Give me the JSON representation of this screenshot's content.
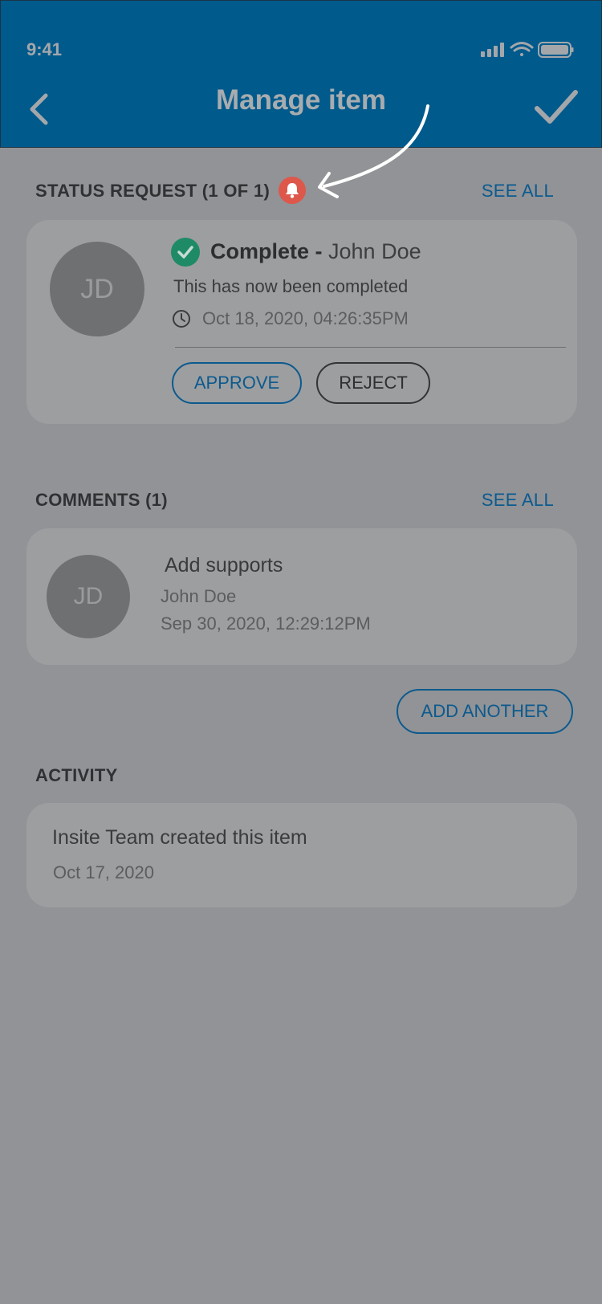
{
  "status_bar": {
    "time": "9:41"
  },
  "header": {
    "title": "Manage item"
  },
  "status_request": {
    "title": "STATUS REQUEST (1 OF 1)",
    "see_all": "SEE ALL",
    "card": {
      "initials": "JD",
      "status": "Complete - ",
      "user": "John Doe",
      "message": "This has now been completed",
      "timestamp": "Oct 18, 2020, 04:26:35PM",
      "approve": "APPROVE",
      "reject": "REJECT"
    }
  },
  "comments": {
    "title": "COMMENTS (1)",
    "see_all": "SEE ALL",
    "item": {
      "initials": "JD",
      "text": "Add supports",
      "author": "John Doe",
      "timestamp": "Sep 30, 2020, 12:29:12PM"
    },
    "add_another": "ADD ANOTHER"
  },
  "activity": {
    "title": "ACTIVITY",
    "item": {
      "text": "Insite Team created this item",
      "date": "Oct 17, 2020"
    }
  },
  "colors": {
    "header_bg": "#015a8c",
    "accent": "#0b5a90",
    "alert": "#dd584b",
    "success": "#1f8b66",
    "overlay_bg": "#929396"
  },
  "icons": [
    "back-chevron-icon",
    "checkmark-icon",
    "bell-icon",
    "check-circle-icon",
    "clock-icon",
    "signal-icon",
    "wifi-icon",
    "battery-icon",
    "annotation-arrow"
  ]
}
